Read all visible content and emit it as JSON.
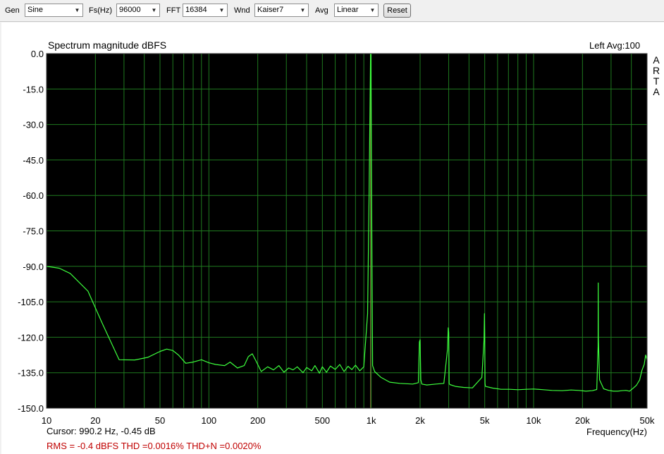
{
  "toolbar": {
    "gen_label": "Gen",
    "gen_value": "Sine",
    "fs_label": "Fs(Hz)",
    "fs_value": "96000",
    "fft_label": "FFT",
    "fft_value": "16384",
    "wnd_label": "Wnd",
    "wnd_value": "Kaiser7",
    "avg_label": "Avg",
    "avg_value": "Linear",
    "reset_label": "Reset"
  },
  "header": {
    "title": "Spectrum magnitude dBFS",
    "channel_avg": "Left  Avg:100",
    "brand_letters": [
      "A",
      "R",
      "T",
      "A"
    ]
  },
  "footer": {
    "cursor": "Cursor:   990.2 Hz, -0.45 dB",
    "stats": "RMS =   -0.4 dBFS   THD =0.0016%   THD+N =0.0020%"
  },
  "colors": {
    "plot_bg": "#000000",
    "grid": "#1f7a1f",
    "trace": "#3dff3d",
    "stats_text": "#c00000"
  },
  "chart_data": {
    "type": "line",
    "title": "Spectrum magnitude dBFS",
    "xlabel": "Frequency(Hz)",
    "ylabel": "",
    "x_scale": "log",
    "xlim": [
      10,
      50000
    ],
    "ylim": [
      -150,
      0
    ],
    "grid": true,
    "x_ticks": [
      10,
      20,
      50,
      100,
      200,
      500,
      1000,
      2000,
      5000,
      10000,
      20000,
      50000
    ],
    "x_tick_labels": [
      "10",
      "20",
      "50",
      "100",
      "200",
      "500",
      "1k",
      "2k",
      "5k",
      "10k",
      "20k",
      "50k"
    ],
    "y_ticks": [
      0,
      -15,
      -30,
      -45,
      -60,
      -75,
      -90,
      -105,
      -120,
      -135,
      -150
    ],
    "y_tick_labels": [
      "0.0",
      "-15.0",
      "-30.0",
      "-45.0",
      "-60.0",
      "-75.0",
      "-90.0",
      "-105.0",
      "-120.0",
      "-135.0",
      "-150.0"
    ],
    "series": [
      {
        "x": [
          10,
          12,
          14,
          18,
          22,
          28,
          35,
          42,
          50,
          55,
          60,
          65,
          72,
          80,
          90,
          100,
          110,
          125,
          135,
          150,
          165,
          175,
          185,
          195,
          210,
          230,
          250,
          270,
          290,
          310,
          330,
          350,
          380,
          400,
          430,
          450,
          480,
          500,
          530,
          560,
          600,
          640,
          680,
          720,
          760,
          800,
          850,
          900,
          950,
          970,
          985,
          990,
          995,
          1005,
          1020,
          1050,
          1150,
          1300,
          1500,
          1800,
          1950,
          1980,
          2000,
          2020,
          2050,
          2200,
          2500,
          2800,
          2950,
          2980,
          3000,
          3020,
          3050,
          3300,
          3700,
          4200,
          4800,
          4950,
          4980,
          5000,
          5020,
          5050,
          5600,
          6300,
          7100,
          8000,
          9000,
          10000,
          11500,
          13000,
          15000,
          17000,
          19000,
          21000,
          23000,
          24500,
          24950,
          25000,
          25050,
          25500,
          27000,
          29000,
          31000,
          33000,
          35000,
          37000,
          39000,
          41000,
          43000,
          45000,
          46500,
          48000,
          49000,
          50000
        ],
        "y": [
          -90,
          -90.8,
          -93,
          -100.5,
          -114,
          -129.5,
          -129.6,
          -128.5,
          -126,
          -125,
          -125.6,
          -127.5,
          -131,
          -130.5,
          -129.5,
          -130.8,
          -131.5,
          -132,
          -130.5,
          -133,
          -132,
          -128.2,
          -127,
          -130,
          -134.5,
          -132.5,
          -133.8,
          -132,
          -134.8,
          -133,
          -133.8,
          -132.5,
          -135,
          -132.8,
          -134.2,
          -132,
          -135.2,
          -132.5,
          -134.8,
          -132.2,
          -133.6,
          -131.5,
          -134.5,
          -132.3,
          -133.7,
          -131.8,
          -134.2,
          -132.5,
          -110,
          -60,
          -15,
          0,
          -0.45,
          -60,
          -132,
          -134.5,
          -137,
          -139,
          -139.5,
          -139.8,
          -139.2,
          -122,
          -121,
          -138,
          -139.8,
          -140.2,
          -139.8,
          -139.5,
          -125,
          -116,
          -118,
          -139.5,
          -140,
          -140.8,
          -141.2,
          -141.4,
          -137,
          -121,
          -110,
          -120,
          -139.5,
          -140.8,
          -141.5,
          -142,
          -142,
          -142.2,
          -142,
          -141.9,
          -142.2,
          -142.5,
          -142.6,
          -142.3,
          -142.5,
          -142.8,
          -142.6,
          -142.1,
          -124,
          -97,
          -120,
          -138,
          -141.8,
          -142.5,
          -142.8,
          -142.8,
          -142.6,
          -142.5,
          -142.8,
          -141.6,
          -140.3,
          -138,
          -134,
          -131.5,
          -127.5,
          -129.5
        ]
      }
    ]
  }
}
